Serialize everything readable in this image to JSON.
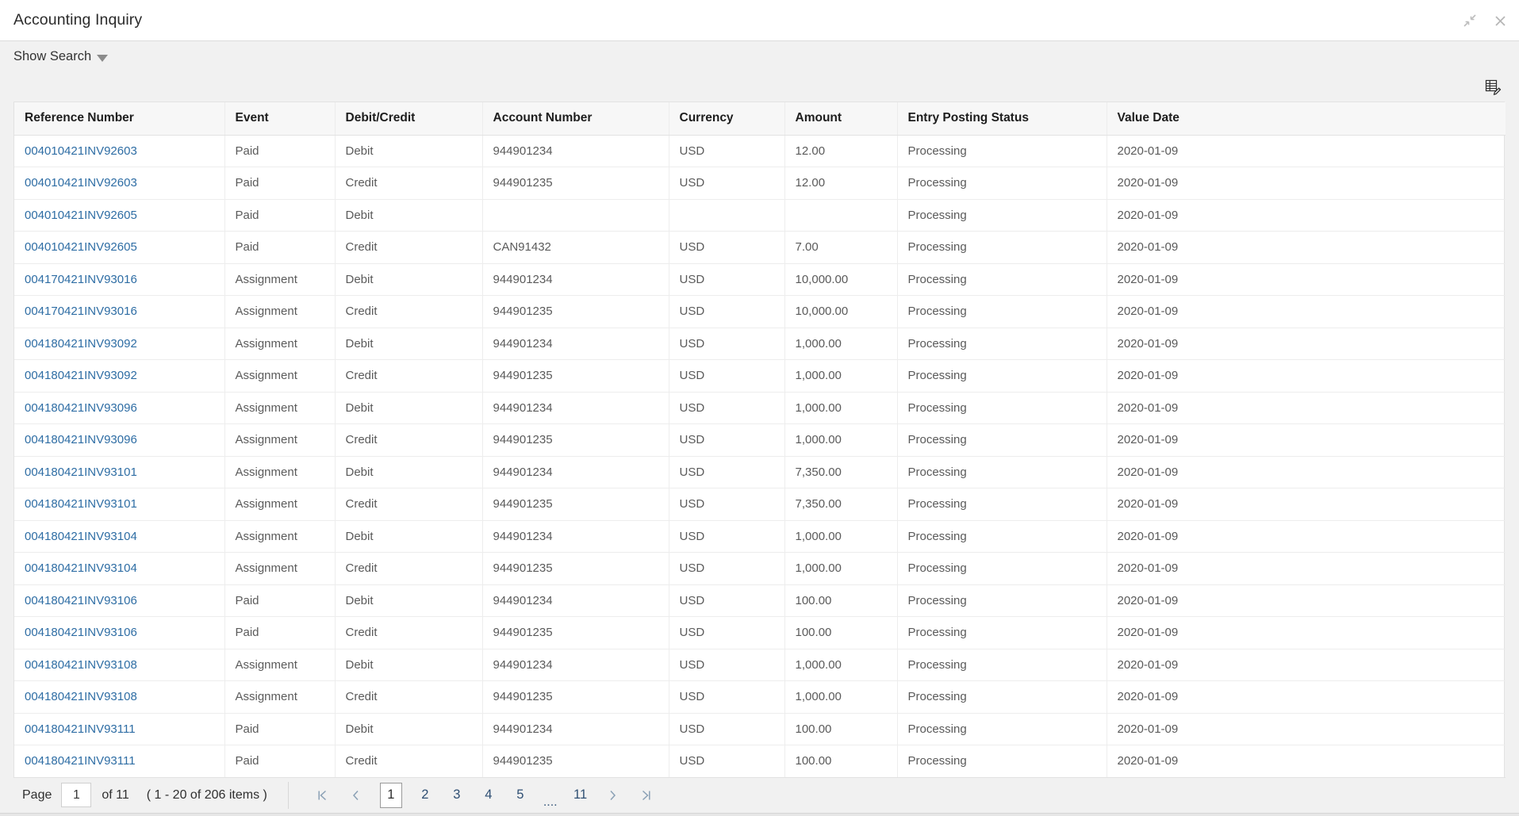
{
  "window": {
    "title": "Accounting Inquiry",
    "restore_icon": "collapse-arrows-icon",
    "close_icon": "close-icon"
  },
  "search": {
    "toggle_label": "Show Search",
    "caret_icon": "caret-down-icon"
  },
  "toolbar": {
    "personalize_icon": "grid-edit-icon"
  },
  "table": {
    "columns": [
      "Reference Number",
      "Event",
      "Debit/Credit",
      "Account Number",
      "Currency",
      "Amount",
      "Entry Posting Status",
      "Value Date"
    ],
    "rows": [
      [
        "004010421INV92603",
        "Paid",
        "Debit",
        "944901234",
        "USD",
        "12.00",
        "Processing",
        "2020-01-09"
      ],
      [
        "004010421INV92603",
        "Paid",
        "Credit",
        "944901235",
        "USD",
        "12.00",
        "Processing",
        "2020-01-09"
      ],
      [
        "004010421INV92605",
        "Paid",
        "Debit",
        "",
        "",
        "",
        "Processing",
        "2020-01-09"
      ],
      [
        "004010421INV92605",
        "Paid",
        "Credit",
        "CAN91432",
        "USD",
        "7.00",
        "Processing",
        "2020-01-09"
      ],
      [
        "004170421INV93016",
        "Assignment",
        "Debit",
        "944901234",
        "USD",
        "10,000.00",
        "Processing",
        "2020-01-09"
      ],
      [
        "004170421INV93016",
        "Assignment",
        "Credit",
        "944901235",
        "USD",
        "10,000.00",
        "Processing",
        "2020-01-09"
      ],
      [
        "004180421INV93092",
        "Assignment",
        "Debit",
        "944901234",
        "USD",
        "1,000.00",
        "Processing",
        "2020-01-09"
      ],
      [
        "004180421INV93092",
        "Assignment",
        "Credit",
        "944901235",
        "USD",
        "1,000.00",
        "Processing",
        "2020-01-09"
      ],
      [
        "004180421INV93096",
        "Assignment",
        "Debit",
        "944901234",
        "USD",
        "1,000.00",
        "Processing",
        "2020-01-09"
      ],
      [
        "004180421INV93096",
        "Assignment",
        "Credit",
        "944901235",
        "USD",
        "1,000.00",
        "Processing",
        "2020-01-09"
      ],
      [
        "004180421INV93101",
        "Assignment",
        "Debit",
        "944901234",
        "USD",
        "7,350.00",
        "Processing",
        "2020-01-09"
      ],
      [
        "004180421INV93101",
        "Assignment",
        "Credit",
        "944901235",
        "USD",
        "7,350.00",
        "Processing",
        "2020-01-09"
      ],
      [
        "004180421INV93104",
        "Assignment",
        "Debit",
        "944901234",
        "USD",
        "1,000.00",
        "Processing",
        "2020-01-09"
      ],
      [
        "004180421INV93104",
        "Assignment",
        "Credit",
        "944901235",
        "USD",
        "1,000.00",
        "Processing",
        "2020-01-09"
      ],
      [
        "004180421INV93106",
        "Paid",
        "Debit",
        "944901234",
        "USD",
        "100.00",
        "Processing",
        "2020-01-09"
      ],
      [
        "004180421INV93106",
        "Paid",
        "Credit",
        "944901235",
        "USD",
        "100.00",
        "Processing",
        "2020-01-09"
      ],
      [
        "004180421INV93108",
        "Assignment",
        "Debit",
        "944901234",
        "USD",
        "1,000.00",
        "Processing",
        "2020-01-09"
      ],
      [
        "004180421INV93108",
        "Assignment",
        "Credit",
        "944901235",
        "USD",
        "1,000.00",
        "Processing",
        "2020-01-09"
      ],
      [
        "004180421INV93111",
        "Paid",
        "Debit",
        "944901234",
        "USD",
        "100.00",
        "Processing",
        "2020-01-09"
      ],
      [
        "004180421INV93111",
        "Paid",
        "Credit",
        "944901235",
        "USD",
        "100.00",
        "Processing",
        "2020-01-09"
      ]
    ]
  },
  "pager": {
    "page_label": "Page",
    "page_value": "1",
    "of_label": "of 11",
    "items_label": "( 1 - 20 of 206 items )",
    "first_icon": "first-page-icon",
    "prev_icon": "previous-page-icon",
    "next_icon": "next-page-icon",
    "last_icon": "last-page-icon",
    "pages": [
      "1",
      "2",
      "3",
      "4",
      "5"
    ],
    "ellipsis": "....",
    "last_page": "11",
    "current_page": "1"
  },
  "colors": {
    "link": "#2e6da4",
    "header_text": "#1d1d1d",
    "cell_text": "#5a5a5a",
    "page_background": "#f1f1f1",
    "grid_background": "#ffffff",
    "header_background": "#f7f7f7",
    "border": "#e2e2e2"
  }
}
